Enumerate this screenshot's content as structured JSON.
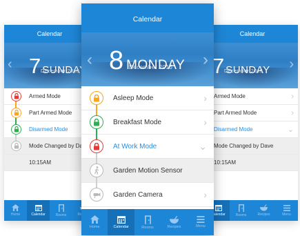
{
  "screens": {
    "left": {
      "header": "Calendar",
      "day_number": "7",
      "day_name": "SUNDAY",
      "month_year": "December 2015",
      "items": [
        {
          "label": "Armed Mode"
        },
        {
          "label": "Part Armed Mode"
        },
        {
          "label": "Disarmed Mode"
        },
        {
          "label": "Mode Changed by Dave"
        },
        {
          "label": "10:15AM"
        }
      ],
      "tabs": [
        "Home",
        "Calendar",
        "Rooms",
        "Recipes"
      ]
    },
    "center": {
      "header": "Calendar",
      "day_number": "8",
      "day_name": "MONDAY",
      "month_year": "December 2015",
      "items": [
        {
          "label": "Asleep Mode"
        },
        {
          "label": "Breakfast Mode"
        },
        {
          "label": "At Work Mode"
        },
        {
          "label": "Garden Motion Sensor"
        },
        {
          "label": "Garden Camera"
        }
      ],
      "tabs": [
        "Home",
        "Calendar",
        "Rooms",
        "Recipes",
        "Menu"
      ]
    },
    "right": {
      "header": "Calendar",
      "day_number": "7",
      "day_name": "SUNDAY",
      "month_year": "December 2015",
      "items": [
        {
          "label": "Armed Mode"
        },
        {
          "label": "Part Armed Mode"
        },
        {
          "label": "Disarmed Mode"
        },
        {
          "label": "Mode Changed by Dave"
        },
        {
          "label": "10:15AM"
        }
      ],
      "tabs": [
        "Calendar",
        "Rooms",
        "Recipes",
        "Menu"
      ]
    }
  },
  "icons": {
    "mode": "padlock-icon",
    "motion": "walking-person-icon",
    "camera": "camera-icon",
    "tabs": [
      "home-icon",
      "calendar-icon",
      "rooms-icon",
      "recipes-icon",
      "menu-icon"
    ]
  },
  "colors": {
    "accent": "#1e86d6",
    "active_text": "#2a8ee0",
    "armed": "#e53935",
    "part_armed": "#f5a623",
    "disarmed": "#2eae52",
    "inactive": "#b9b9b9"
  }
}
